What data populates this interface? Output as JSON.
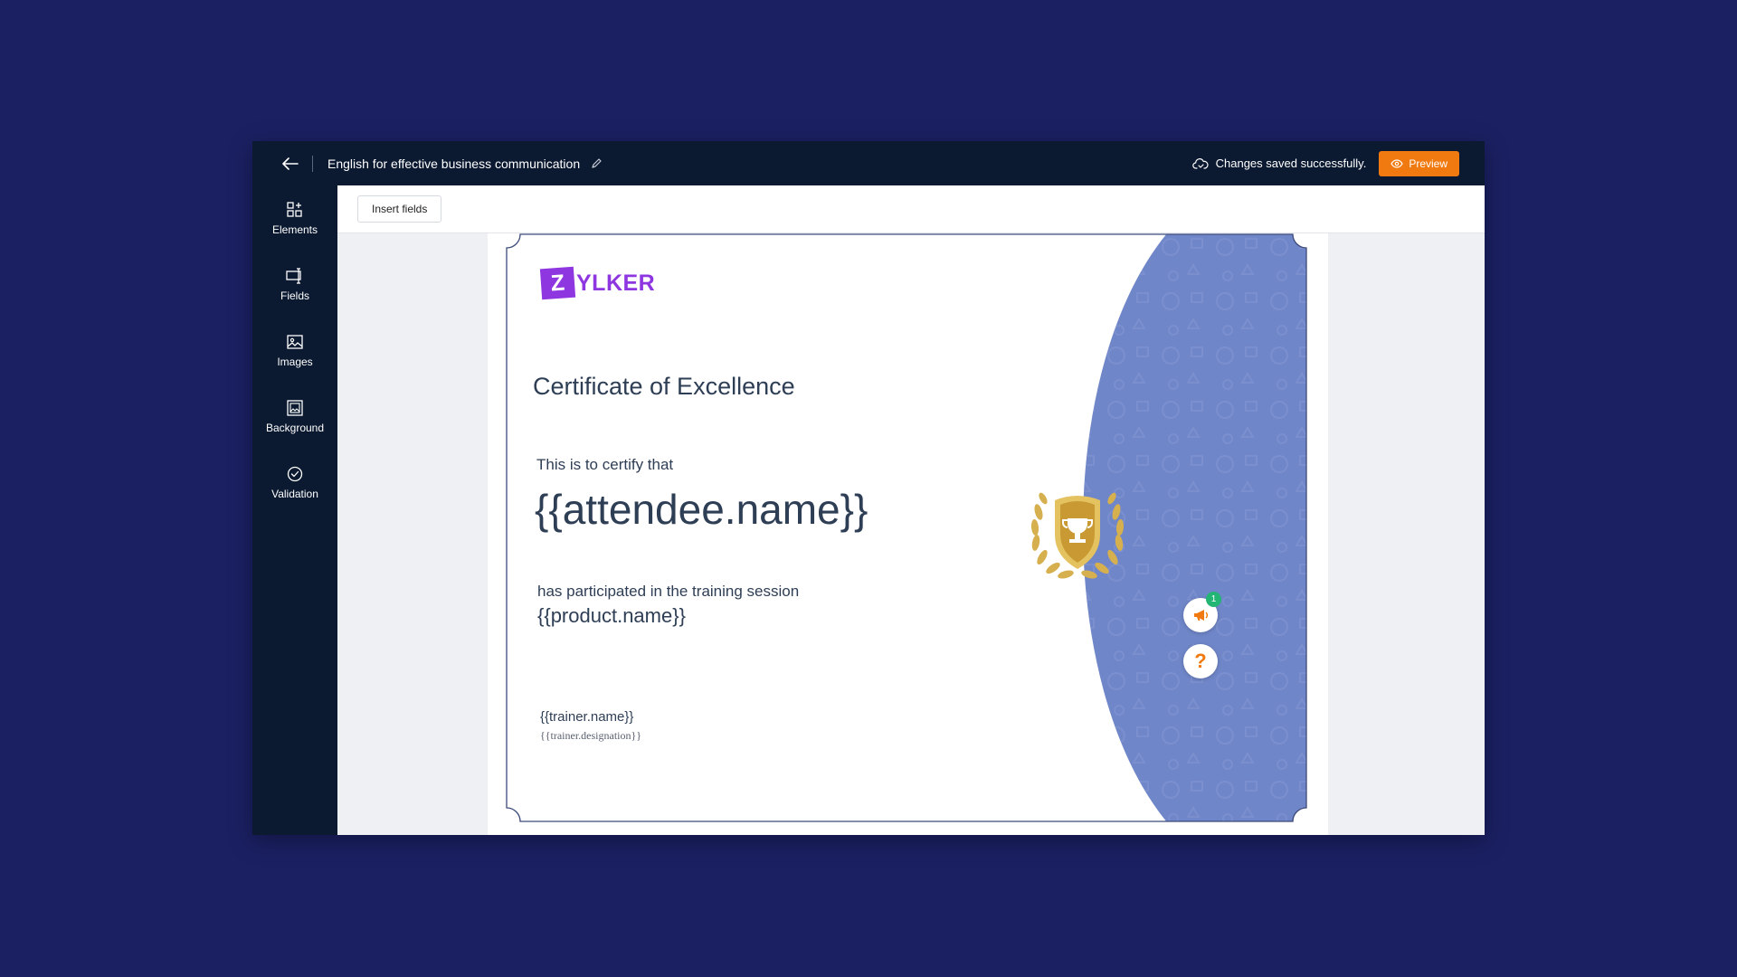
{
  "topbar": {
    "title": "English for effective business communication",
    "save_status": "Changes saved successfully.",
    "preview_label": "Preview"
  },
  "sidebar": {
    "items": [
      {
        "label": "Elements",
        "icon": "elements-icon"
      },
      {
        "label": "Fields",
        "icon": "fields-icon"
      },
      {
        "label": "Images",
        "icon": "image-icon"
      },
      {
        "label": "Background",
        "icon": "background-icon"
      },
      {
        "label": "Validation",
        "icon": "check-circle-icon"
      }
    ]
  },
  "toolbar": {
    "insert_fields_label": "Insert fields"
  },
  "certificate": {
    "logo_letter": "Z",
    "logo_text": "YLKER",
    "title": "Certificate of Excellence",
    "certify_line": "This is to certify that",
    "attendee_field": "{{attendee.name}}",
    "participated_line": "has participated in the training session",
    "product_field": "{{product.name}}",
    "trainer_name_field": "{{trainer.name}}",
    "trainer_designation_field": "{{trainer.designation}}"
  },
  "floating": {
    "notification_count": "1",
    "help_label": "?"
  },
  "colors": {
    "background": "#1b2063",
    "topbar": "#0b1a31",
    "accent": "#f07a10",
    "brand": "#8e36e0",
    "cert_blue": "#6f86c8",
    "gold": "#d6b04e",
    "notification": "#22b573"
  }
}
